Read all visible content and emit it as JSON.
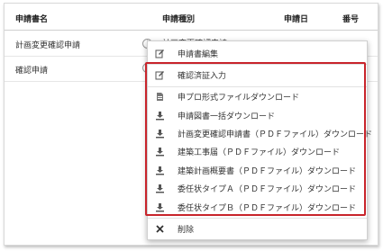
{
  "table": {
    "columns": [
      "申請書名",
      "申請種別",
      "申請日",
      "番号"
    ],
    "rows": [
      {
        "name": "計画変更確認申請",
        "type": "計画変更確認申請"
      },
      {
        "name": "確認申請",
        "type": ""
      }
    ]
  },
  "menu": {
    "items": [
      {
        "label": "申請書編集",
        "icon": "edit-icon"
      },
      {
        "label": "確認済証入力",
        "icon": "edit-icon"
      },
      {
        "label": "申プロ形式ファイルダウンロード",
        "icon": "document-icon"
      },
      {
        "label": "申請図書一括ダウンロード",
        "icon": "download-icon"
      },
      {
        "label": "計画変更確認申請書（ＰＤＦファイル）ダウンロード",
        "icon": "download-icon"
      },
      {
        "label": "建築工事届（ＰＤＦファイル）ダウンロード",
        "icon": "download-icon"
      },
      {
        "label": "建築計画概要書（ＰＤＦファイル）ダウンロード",
        "icon": "download-icon"
      },
      {
        "label": "委任状タイプＡ（ＰＤＦファイル）ダウンロード",
        "icon": "download-icon"
      },
      {
        "label": "委任状タイプＢ（ＰＤＦファイル）ダウンロード",
        "icon": "download-icon"
      },
      {
        "label": "削除",
        "icon": "close-icon"
      }
    ]
  },
  "colors": {
    "highlight": "#c8242b",
    "icon": "#555555"
  }
}
